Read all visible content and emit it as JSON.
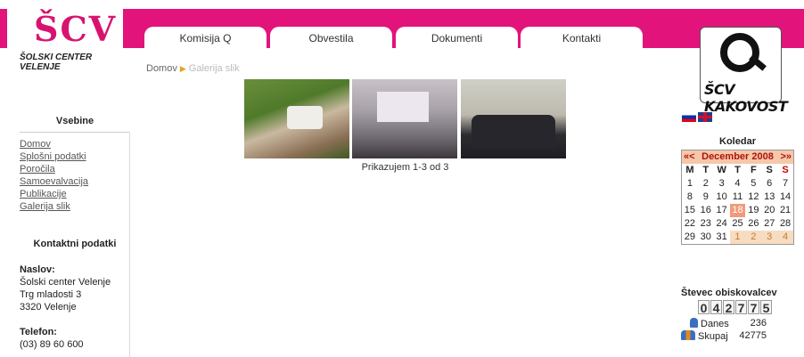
{
  "header": {
    "logo_letters": "ŠCV",
    "logo_caption": "ŠOLSKI CENTER VELENJE",
    "tabs": [
      "Komisija Q",
      "Obvestila",
      "Dokumenti",
      "Kontakti"
    ],
    "kakovost_logo_text": "ŠCV KAKOVOST",
    "brand_color": "#e2147c"
  },
  "breadcrumb": {
    "home": "Domov",
    "current": "Galerija slik"
  },
  "sidebar": {
    "title": "Vsebine",
    "items": [
      "Domov",
      "Splošni podatki",
      "Poročila",
      "Samoevalvacija",
      "Publikacije",
      "Galerija slik"
    ],
    "contact_title": "Kontaktni podatki",
    "address_label": "Naslov:",
    "address_lines": [
      "Šolski center Velenje",
      "Trg mladosti 3",
      "3320 Velenje"
    ],
    "phone_label": "Telefon:",
    "phone": "(03) 89 60 600"
  },
  "gallery": {
    "caption": "Prikazujem 1-3 od 3"
  },
  "calendar": {
    "title": "Koledar",
    "prev": "«<",
    "month": "December 2008",
    "next": ">»",
    "weekdays": [
      "M",
      "T",
      "W",
      "T",
      "F",
      "S",
      "S"
    ],
    "days": [
      "1",
      "2",
      "3",
      "4",
      "5",
      "6",
      "7",
      "8",
      "9",
      "10",
      "11",
      "12",
      "13",
      "14",
      "15",
      "16",
      "17",
      "18",
      "19",
      "20",
      "21",
      "22",
      "23",
      "24",
      "25",
      "26",
      "27",
      "28",
      "29",
      "30",
      "31",
      "1",
      "2",
      "3",
      "4"
    ],
    "today": "18"
  },
  "counter": {
    "title": "Števec obiskovalcev",
    "digits": [
      "0",
      "4",
      "2",
      "7",
      "7",
      "5"
    ],
    "today_label": "Danes",
    "today_value": "236",
    "total_label": "Skupaj",
    "total_value": "42775"
  }
}
